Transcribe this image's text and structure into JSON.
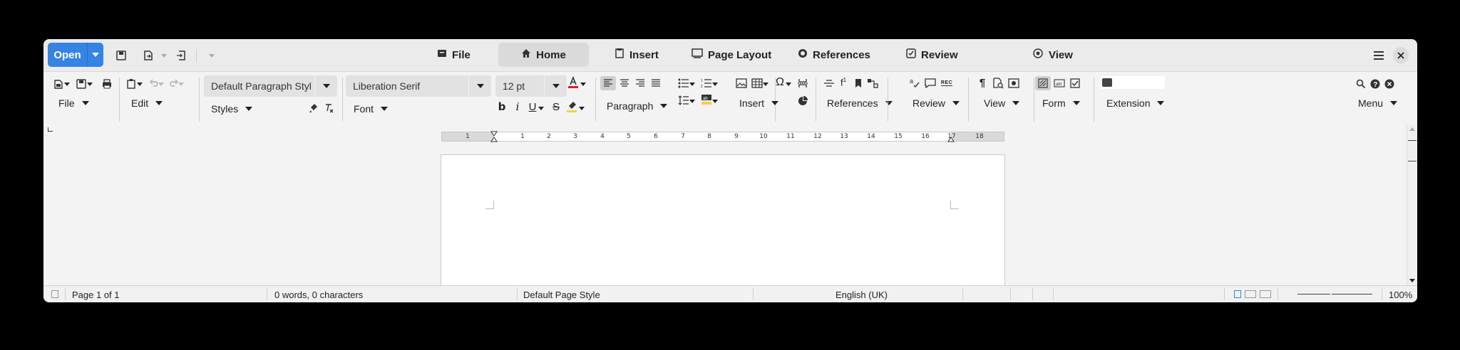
{
  "titlebar": {
    "open_label": "Open",
    "tabs": [
      {
        "label": "File",
        "icon": "file-drawer-icon",
        "active": false
      },
      {
        "label": "Home",
        "icon": "home-icon",
        "active": true
      },
      {
        "label": "Insert",
        "icon": "insert-icon",
        "active": false
      },
      {
        "label": "Page Layout",
        "icon": "page-layout-icon",
        "active": false
      },
      {
        "label": "References",
        "icon": "references-icon",
        "active": false
      },
      {
        "label": "Review",
        "icon": "review-check-icon",
        "active": false
      },
      {
        "label": "View",
        "icon": "eye-icon",
        "active": false
      }
    ]
  },
  "toolbar": {
    "groups": {
      "file": "File",
      "edit": "Edit",
      "styles": "Styles",
      "font": "Font",
      "paragraph": "Paragraph",
      "insert": "Insert",
      "references": "References",
      "review": "Review",
      "view": "View",
      "form": "Form",
      "extension": "Extension",
      "menu": "Menu"
    },
    "paragraph_style": "Default Paragraph Styl",
    "font_name": "Liberation Serif",
    "font_size": "12 pt",
    "font_color": "#e01b24",
    "highlight_color": "#f6d32d"
  },
  "ruler": {
    "ticks": [
      "1",
      "1",
      "2",
      "3",
      "4",
      "5",
      "6",
      "7",
      "8",
      "9",
      "10",
      "11",
      "12",
      "13",
      "14",
      "15",
      "16",
      "17",
      "18"
    ]
  },
  "statusbar": {
    "page": "Page 1 of 1",
    "words": "0 words, 0 characters",
    "page_style": "Default Page Style",
    "language": "English (UK)",
    "zoom": "100%"
  },
  "colors": {
    "accent": "#3584e4"
  }
}
